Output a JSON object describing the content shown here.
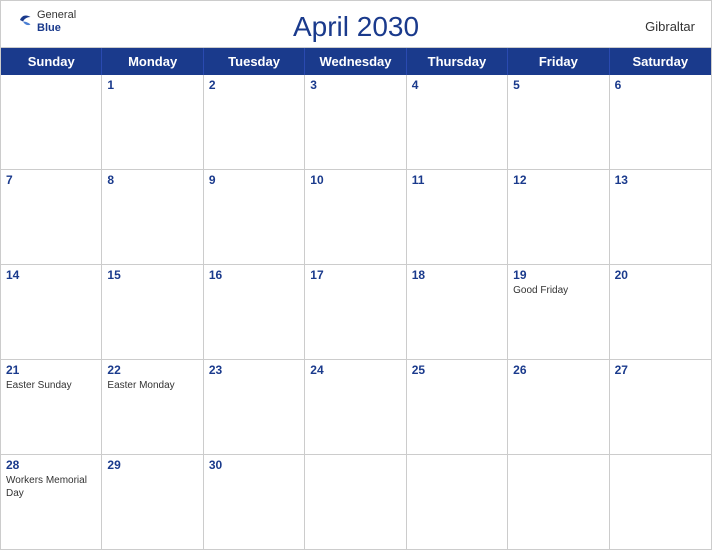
{
  "header": {
    "title": "April 2030",
    "region": "Gibraltar",
    "logo_general": "General",
    "logo_blue": "Blue"
  },
  "day_headers": [
    "Sunday",
    "Monday",
    "Tuesday",
    "Wednesday",
    "Thursday",
    "Friday",
    "Saturday"
  ],
  "weeks": [
    [
      {
        "day": "",
        "holiday": ""
      },
      {
        "day": "1",
        "holiday": ""
      },
      {
        "day": "2",
        "holiday": ""
      },
      {
        "day": "3",
        "holiday": ""
      },
      {
        "day": "4",
        "holiday": ""
      },
      {
        "day": "5",
        "holiday": ""
      },
      {
        "day": "6",
        "holiday": ""
      }
    ],
    [
      {
        "day": "7",
        "holiday": ""
      },
      {
        "day": "8",
        "holiday": ""
      },
      {
        "day": "9",
        "holiday": ""
      },
      {
        "day": "10",
        "holiday": ""
      },
      {
        "day": "11",
        "holiday": ""
      },
      {
        "day": "12",
        "holiday": ""
      },
      {
        "day": "13",
        "holiday": ""
      }
    ],
    [
      {
        "day": "14",
        "holiday": ""
      },
      {
        "day": "15",
        "holiday": ""
      },
      {
        "day": "16",
        "holiday": ""
      },
      {
        "day": "17",
        "holiday": ""
      },
      {
        "day": "18",
        "holiday": ""
      },
      {
        "day": "19",
        "holiday": "Good Friday"
      },
      {
        "day": "20",
        "holiday": ""
      }
    ],
    [
      {
        "day": "21",
        "holiday": "Easter Sunday"
      },
      {
        "day": "22",
        "holiday": "Easter Monday"
      },
      {
        "day": "23",
        "holiday": ""
      },
      {
        "day": "24",
        "holiday": ""
      },
      {
        "day": "25",
        "holiday": ""
      },
      {
        "day": "26",
        "holiday": ""
      },
      {
        "day": "27",
        "holiday": ""
      }
    ],
    [
      {
        "day": "28",
        "holiday": "Workers Memorial Day"
      },
      {
        "day": "29",
        "holiday": ""
      },
      {
        "day": "30",
        "holiday": ""
      },
      {
        "day": "",
        "holiday": ""
      },
      {
        "day": "",
        "holiday": ""
      },
      {
        "day": "",
        "holiday": ""
      },
      {
        "day": "",
        "holiday": ""
      }
    ]
  ]
}
